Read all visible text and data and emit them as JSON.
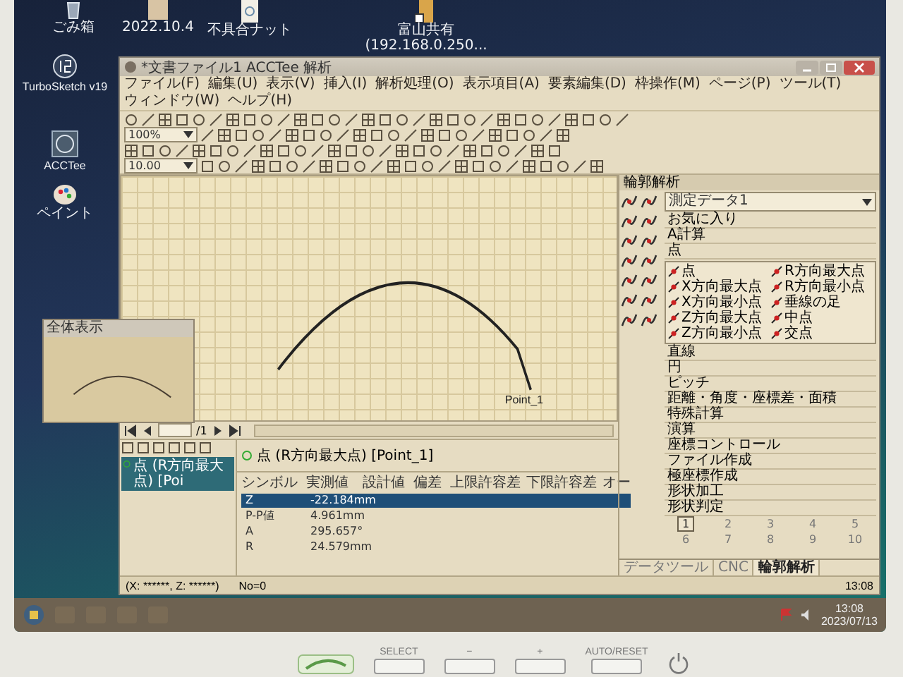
{
  "desktop": {
    "top_icons": [
      {
        "kind": "bin",
        "label": "ごみ箱"
      },
      {
        "kind": "file",
        "label": "2022.10.4"
      },
      {
        "kind": "doc",
        "label": "不具合ナット"
      },
      {
        "kind": "network",
        "label": "富山共有",
        "sublabel": "(192.168.0.250..."
      }
    ],
    "left_icons": [
      {
        "kind": "app19",
        "label": "TurboSketch v19"
      },
      {
        "kind": "appacc",
        "label": "ACCTee"
      },
      {
        "kind": "paint",
        "label": "ペイント"
      }
    ]
  },
  "window": {
    "title": "*文書ファイル1 ACCTee 解析",
    "menu": [
      "ファイル(F)",
      "編集(U)",
      "表示(V)",
      "挿入(I)",
      "解析処理(O)",
      "表示項目(A)",
      "要素編集(D)",
      "枠操作(M)",
      "ページ(P)",
      "ツール(T)",
      "ウィンドウ(W)",
      "ヘルプ(H)"
    ],
    "zoom": "100%",
    "scale": "10.00"
  },
  "canvas": {
    "point_label": "Point_1"
  },
  "overview": {
    "title": "全体表示"
  },
  "navigator": {
    "page_of": "/1"
  },
  "tree": {
    "items": [
      {
        "label": "点 (R方向最大点) [Poi",
        "selected": true
      }
    ]
  },
  "detail": {
    "header": "点 (R方向最大点) [Point_1]",
    "columns": [
      "シンボル",
      "実測値",
      "設計値",
      "偏差",
      "上限許容差",
      "下限許容差",
      "オー"
    ],
    "rows": [
      {
        "cells": [
          "Z",
          "-22.184mm"
        ],
        "selected": true
      },
      {
        "cells": [
          "P-P値",
          "4.961mm"
        ],
        "selected": false
      },
      {
        "cells": [
          "A",
          "295.657°"
        ],
        "selected": false
      },
      {
        "cells": [
          "R",
          "24.579mm"
        ],
        "selected": false
      }
    ]
  },
  "status": {
    "coords": "(X: ******, Z: ******)",
    "number": "No=0",
    "time": "13:08"
  },
  "panel": {
    "title": "輪郭解析",
    "dataset": "測定データ1",
    "categories": [
      "お気に入り",
      "A計算",
      "点"
    ],
    "elements": [
      "点",
      "R方向最大点",
      "X方向最大点",
      "R方向最小点",
      "X方向最小点",
      "垂線の足",
      "Z方向最大点",
      "中点",
      "Z方向最小点",
      "交点"
    ],
    "functions": [
      "直線",
      "円",
      "ピッチ",
      "距離・角度・座標差・面積",
      "特殊計算",
      "演算",
      "座標コントロール",
      "ファイル作成",
      "極座標作成",
      "形状加工",
      "形状判定"
    ],
    "pages": [
      {
        "label": "1",
        "selected": true
      },
      {
        "label": "2",
        "selected": false
      },
      {
        "label": "3",
        "selected": false
      },
      {
        "label": "4",
        "selected": false
      },
      {
        "label": "5",
        "selected": false
      },
      {
        "label": "6",
        "selected": false
      },
      {
        "label": "7",
        "selected": false
      },
      {
        "label": "8",
        "selected": false
      },
      {
        "label": "9",
        "selected": false
      },
      {
        "label": "10",
        "selected": false
      }
    ],
    "tabs": [
      {
        "label": "データツール",
        "selected": false
      },
      {
        "label": "CNC",
        "selected": false
      },
      {
        "label": "輪郭解析",
        "selected": true
      }
    ]
  },
  "taskbar": {
    "time": "13:08",
    "date": "2023/07/13"
  },
  "monitor": {
    "buttons": [
      "SELECT",
      "−",
      "+",
      "AUTO/RESET"
    ]
  }
}
